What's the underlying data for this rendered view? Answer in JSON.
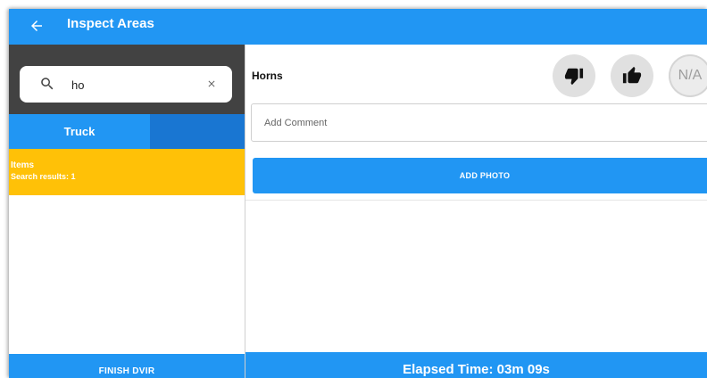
{
  "topbar": {
    "title": "Inspect Areas",
    "back_icon": "arrow-left-icon"
  },
  "search": {
    "value": "ho",
    "search_icon": "search-icon",
    "clear_icon": "close-icon"
  },
  "tabs": [
    {
      "label": "Truck",
      "active": true
    },
    {
      "label": "",
      "active": false
    }
  ],
  "results": {
    "label": "Items",
    "count_text": "Search results: 1"
  },
  "sidebar": {
    "finish_label": "FINISH DVIR"
  },
  "item": {
    "name": "Horns",
    "defect_icon": "thumbs-down-icon",
    "ok_icon": "thumbs-up-icon",
    "na_label": "N/A",
    "comment_placeholder": "Add Comment",
    "add_photo_label": "ADD PHOTO"
  },
  "footer": {
    "elapsed_text": "Elapsed Time:  03m 09s"
  },
  "colors": {
    "primary": "#2196f3",
    "primary_dark": "#1976d2",
    "search_bg": "#424242",
    "highlight": "#ffc107"
  }
}
